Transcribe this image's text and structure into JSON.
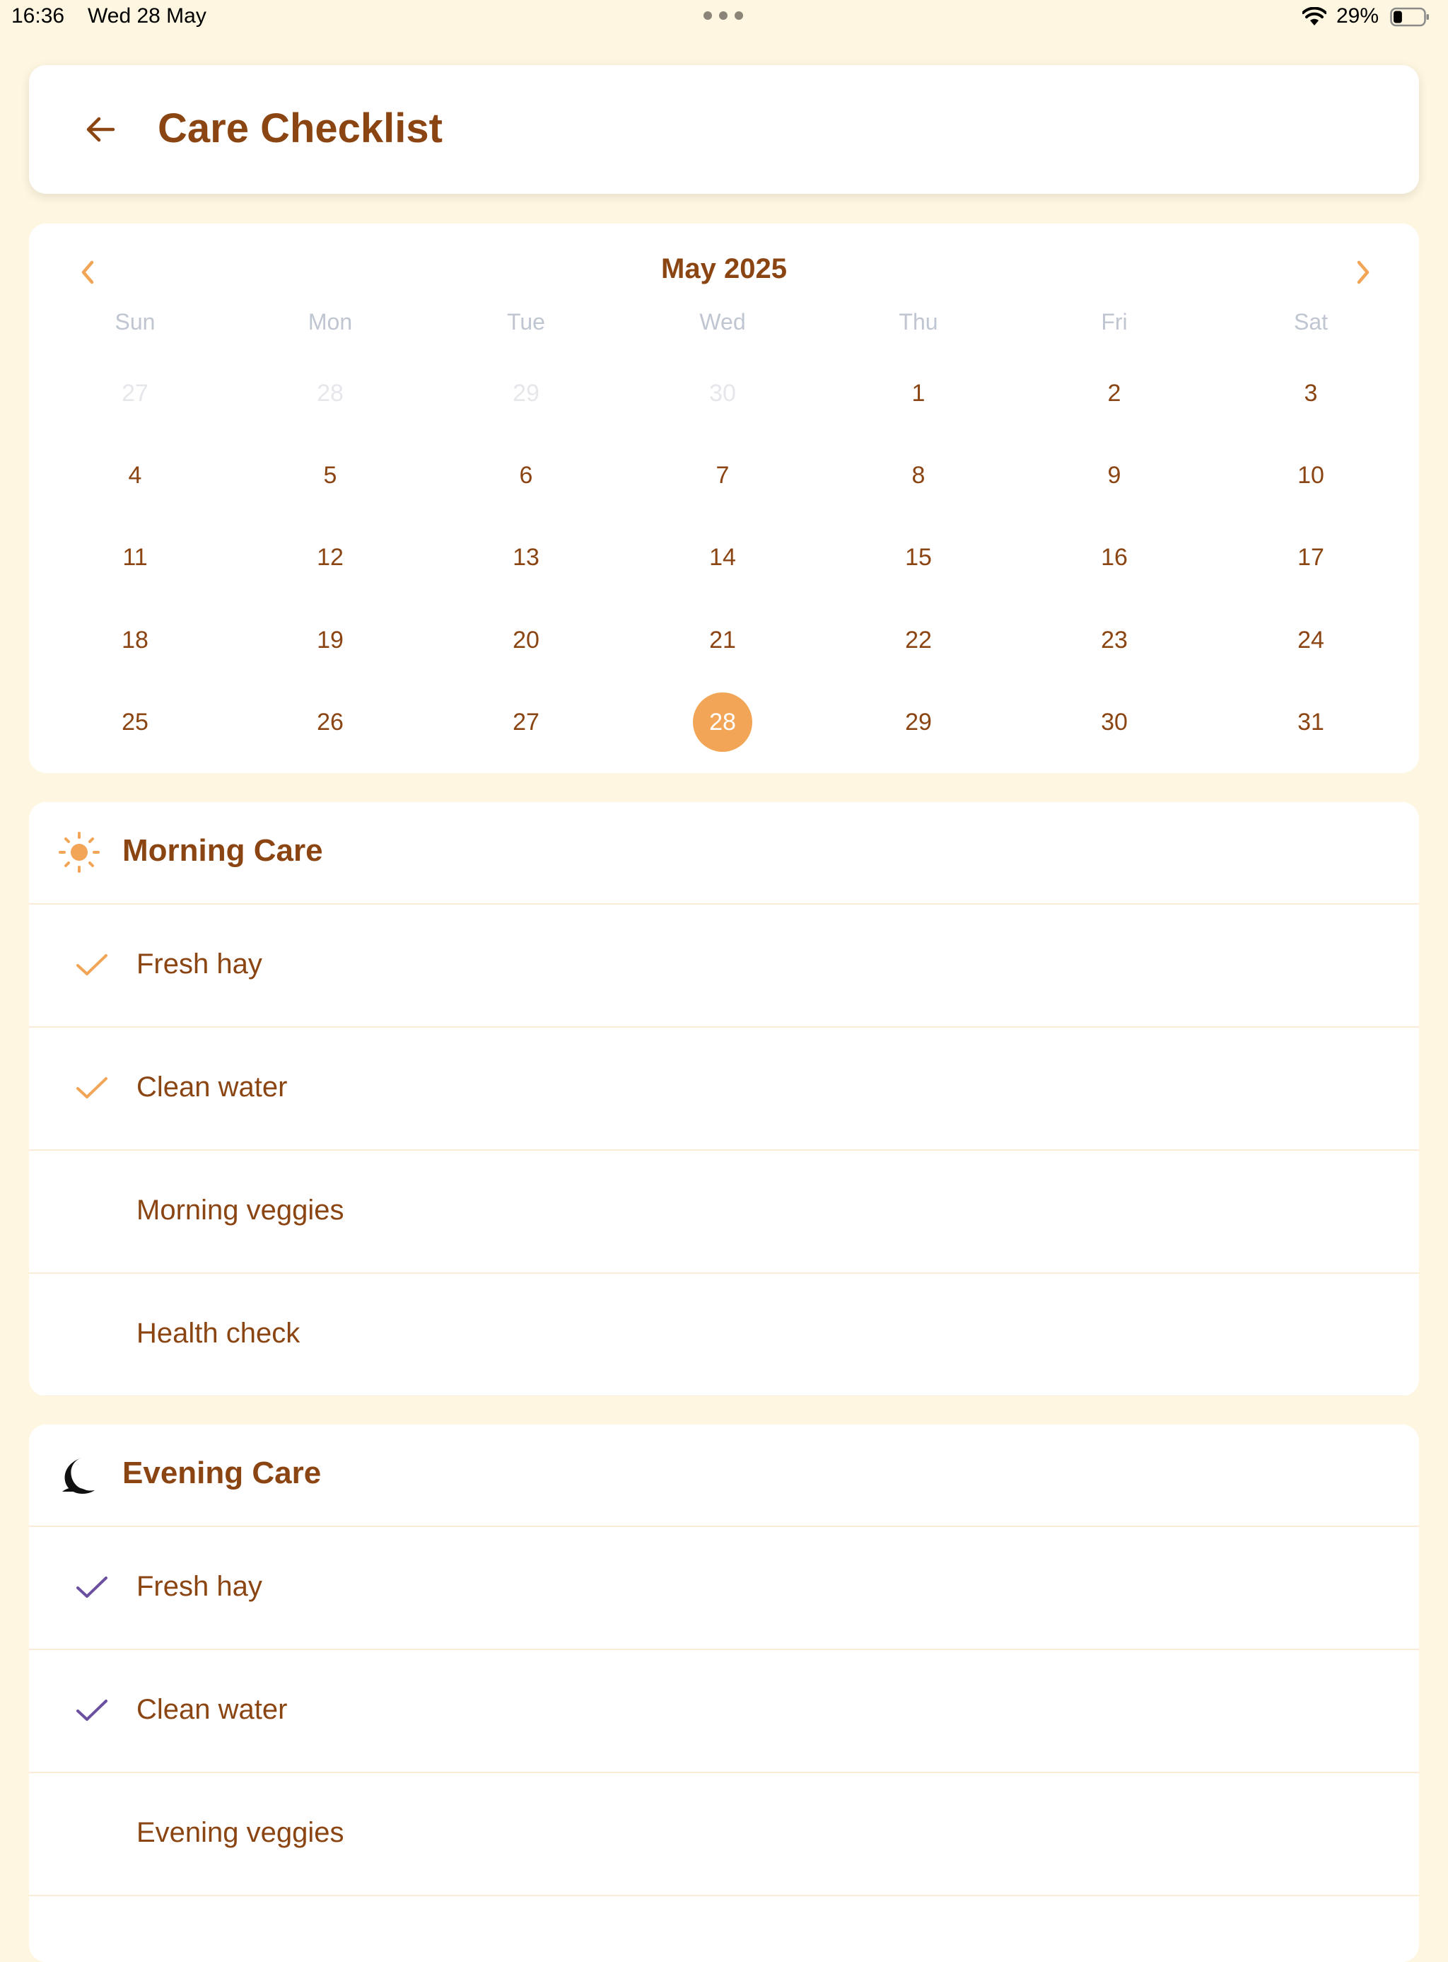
{
  "status_bar": {
    "time": "16:36",
    "date": "Wed 28 May",
    "battery_percent": "29%",
    "battery_level": 0.29
  },
  "header": {
    "title": "Care Checklist"
  },
  "calendar": {
    "month_label": "May 2025",
    "weekdays": [
      "Sun",
      "Mon",
      "Tue",
      "Wed",
      "Thu",
      "Fri",
      "Sat"
    ],
    "weeks": [
      [
        "27",
        "28",
        "29",
        "30",
        "1",
        "2",
        "3"
      ],
      [
        "4",
        "5",
        "6",
        "7",
        "8",
        "9",
        "10"
      ],
      [
        "11",
        "12",
        "13",
        "14",
        "15",
        "16",
        "17"
      ],
      [
        "18",
        "19",
        "20",
        "21",
        "22",
        "23",
        "24"
      ],
      [
        "25",
        "26",
        "27",
        "28",
        "29",
        "30",
        "31"
      ]
    ],
    "outside_month_days_first_row": 4,
    "selected_day": "28"
  },
  "morning": {
    "title": "Morning Care",
    "icon": "sun-icon",
    "check_color": "#F2A556",
    "tasks": [
      {
        "label": "Fresh hay",
        "done": true
      },
      {
        "label": "Clean water",
        "done": true
      },
      {
        "label": "Morning veggies",
        "done": false
      },
      {
        "label": "Health check",
        "done": false
      }
    ]
  },
  "evening": {
    "title": "Evening Care",
    "icon": "moon-icon",
    "check_color": "#6B4FA0",
    "tasks": [
      {
        "label": "Fresh hay",
        "done": true
      },
      {
        "label": "Clean water",
        "done": true
      },
      {
        "label": "Evening veggies",
        "done": false
      }
    ]
  },
  "colors": {
    "background": "#FEF6E0",
    "accent": "#F2A556",
    "text_brown": "#8B4513",
    "evening_accent": "#6B4FA0"
  }
}
